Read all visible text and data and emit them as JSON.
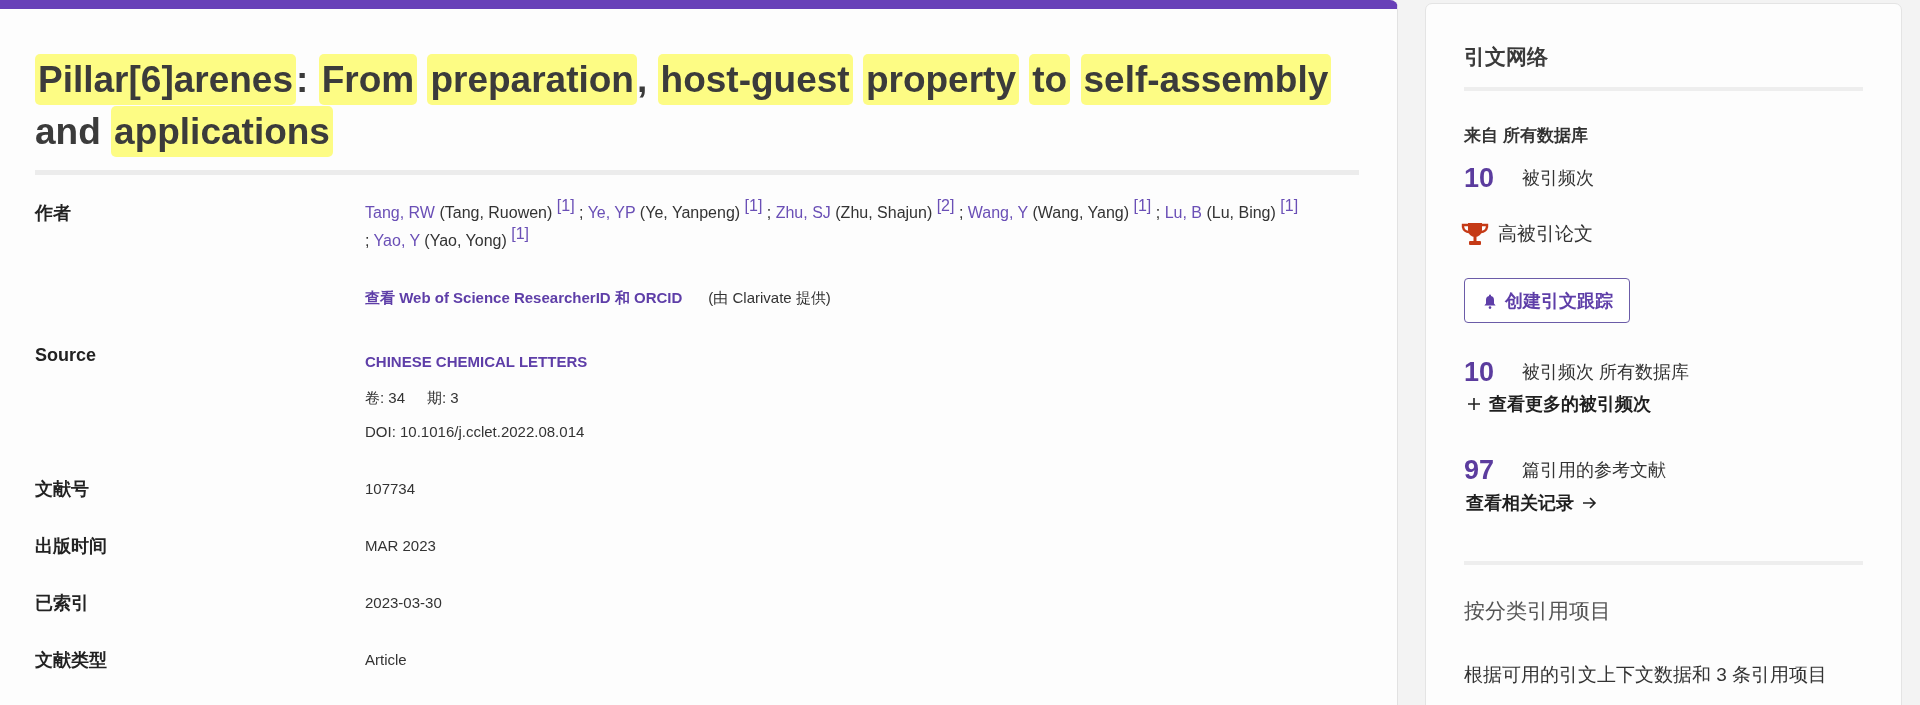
{
  "article": {
    "title": {
      "segments": [
        {
          "text": "Pillar[6]arenes",
          "highlighted": true
        },
        {
          "text": ": ",
          "highlighted": false
        },
        {
          "text": "From",
          "highlighted": true
        },
        {
          "text": "preparation",
          "highlighted": true
        },
        {
          "text": ", ",
          "highlighted": false
        },
        {
          "text": "host-guest",
          "highlighted": true
        },
        {
          "text": "property",
          "highlighted": true
        },
        {
          "text": "to",
          "highlighted": true
        },
        {
          "text": "self-assembly",
          "highlighted": true
        },
        {
          "text": " and ",
          "highlighted": false
        },
        {
          "text": "applications",
          "highlighted": true
        }
      ]
    },
    "fields": [
      {
        "kind": "authors",
        "label": "作者",
        "separator": ";",
        "authors": [
          {
            "abbrev": "Tang, RW",
            "full_name": "(Tang, Ruowen)",
            "affiliation": "[1]"
          },
          {
            "abbrev": "Ye, YP",
            "full_name": "(Ye, Yanpeng)",
            "affiliation": "[1]"
          },
          {
            "abbrev": "Zhu, SJ",
            "full_name": "(Zhu, Shajun)",
            "affiliation": "[2]"
          },
          {
            "abbrev": "Wang, Y",
            "full_name": "(Wang, Yang)",
            "affiliation": "[1]"
          },
          {
            "abbrev": "Lu, B",
            "full_name": "(Lu, Bing)",
            "affiliation": "[1]"
          },
          {
            "abbrev": "Yao, Y",
            "full_name": "(Yao, Yong)",
            "affiliation": "[1]"
          }
        ],
        "researcher_link": "查看 Web of Science ResearcherID 和 ORCID",
        "provider_note": "(由 Clarivate 提供)"
      },
      {
        "kind": "source",
        "label": "Source",
        "journal": "CHINESE CHEMICAL LETTERS",
        "volume": "卷: 34",
        "issue": "期: 3",
        "doi": "DOI: 10.1016/j.cclet.2022.08.014"
      },
      {
        "kind": "text",
        "label": "文献号",
        "value": "107734"
      },
      {
        "kind": "text",
        "label": "出版时间",
        "value": "MAR 2023"
      },
      {
        "kind": "text",
        "label": "已索引",
        "value": "2023-03-30"
      },
      {
        "kind": "text",
        "label": "文献类型",
        "value": "Article"
      }
    ]
  },
  "citation_network": {
    "title": "引文网络",
    "source_label": "来自 所有数据库",
    "times_cited": {
      "count": "10",
      "label": "被引频次"
    },
    "highly_cited": {
      "label": "高被引论文"
    },
    "alert_button": {
      "label": "创建引文跟踪"
    },
    "all_databases": {
      "count": "10",
      "label": "被引频次 所有数据库"
    },
    "more_citations_link": "查看更多的被引频次",
    "references": {
      "count": "97",
      "label": "篇引用的参考文献"
    },
    "related_records_link": "查看相关记录"
  },
  "citations_by_classification": {
    "title": "按分类引用项目",
    "description": "根据可用的引文上下文数据和 3 条引用项目"
  }
}
